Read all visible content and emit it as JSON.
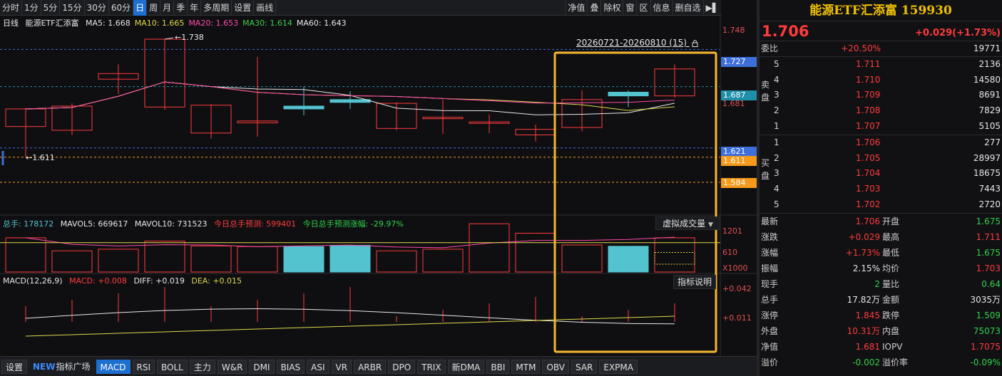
{
  "toolbar": {
    "periods": [
      "分时",
      "1分",
      "5分",
      "15分",
      "30分",
      "60分",
      "日",
      "周",
      "月",
      "季",
      "年",
      "多周期",
      "设置",
      "画线"
    ],
    "active_period": "日",
    "right_items": [
      "净值",
      "叠",
      "除权",
      "窗",
      "区",
      "信息",
      "删自选",
      "▶▌"
    ]
  },
  "chart": {
    "period_label": "日线",
    "name": "能源ETF汇添富",
    "ma_labels": [
      {
        "text": "MA5: 1.668",
        "color": "#e8e8e8"
      },
      {
        "text": "MA10: 1.665",
        "color": "#e0d84a"
      },
      {
        "text": "MA20: 1.653",
        "color": "#ff4aa8"
      },
      {
        "text": "MA30: 1.614",
        "color": "#3ecf4a"
      },
      {
        "text": "MA60: 1.643",
        "color": "#e8e8e8"
      }
    ],
    "range_label": "20260721-20260810 (15)",
    "lock_icon": "lock-icon",
    "price_axis": {
      "top": "1.748",
      "line1": "1.727",
      "line2": "1.687",
      "line2_sub": "1.681",
      "line3": "1.621",
      "line3_sub": "1.611",
      "line4": "1.584"
    },
    "high_marker": "1.738",
    "low_marker": "1.611",
    "candles": [
      {
        "o": 1.644,
        "c": 1.663,
        "h": 1.664,
        "l": 1.611
      },
      {
        "o": 1.64,
        "c": 1.666,
        "h": 1.669,
        "l": 1.635
      },
      {
        "o": 1.695,
        "c": 1.701,
        "h": 1.711,
        "l": 1.679
      },
      {
        "o": 1.665,
        "c": 1.738,
        "h": 1.738,
        "l": 1.662
      },
      {
        "o": 1.637,
        "c": 1.667,
        "h": 1.668,
        "l": 1.631
      },
      {
        "o": 1.648,
        "c": 1.65,
        "h": 1.719,
        "l": 1.633
      },
      {
        "o": 1.666,
        "c": 1.663,
        "h": 1.687,
        "l": 1.656
      },
      {
        "o": 1.673,
        "c": 1.67,
        "h": 1.682,
        "l": 1.663
      },
      {
        "o": 1.642,
        "c": 1.669,
        "h": 1.67,
        "l": 1.64
      },
      {
        "o": 1.654,
        "c": 1.654,
        "h": 1.673,
        "l": 1.636
      },
      {
        "o": 1.649,
        "c": 1.649,
        "h": 1.657,
        "l": 1.637
      },
      {
        "o": 1.635,
        "c": 1.641,
        "h": 1.646,
        "l": 1.628
      },
      {
        "o": 1.643,
        "c": 1.673,
        "h": 1.683,
        "l": 1.639
      },
      {
        "o": 1.681,
        "c": 1.677,
        "h": 1.683,
        "l": 1.665
      },
      {
        "o": 1.677,
        "c": 1.706,
        "h": 1.711,
        "l": 1.675
      }
    ],
    "volume_line": {
      "label": "总手: 178172",
      "mavol5": "MAVOL5: 669617",
      "mavol10": "MAVOL10: 731523",
      "forecast": "今日总手预测: 599401",
      "forecast_change": "今日总手预测涨幅: -29.97%"
    },
    "volume_axis": {
      "top": "1201",
      "mid": "610",
      "unit": "X1000"
    },
    "volumes": [
      1050,
      650,
      700,
      950,
      800,
      780,
      780,
      820,
      650,
      700,
      1480,
      1190,
      830,
      790,
      1050
    ],
    "virtual_volume_button": "虚拟成交量",
    "macd_line": {
      "title": "MACD(12,26,9)",
      "macd": "MACD: +0.008",
      "diff": "DIFF: +0.019",
      "dea": "DEA: +0.015"
    },
    "macd_axis": {
      "top": "+0.042",
      "mid": "+0.011"
    },
    "explain_button": "指标说明"
  },
  "tabs": {
    "settings": "设置",
    "new_badge": "NEW",
    "items": [
      "指标广场",
      "MACD",
      "RSI",
      "BOLL",
      "主力",
      "W&R",
      "DMI",
      "BIAS",
      "ASI",
      "VR",
      "ARBR",
      "DPO",
      "TRIX",
      "新DMA",
      "BBI",
      "MTM",
      "OBV",
      "SAR",
      "EXPMA"
    ],
    "active": "MACD"
  },
  "quote": {
    "title": "能源ETF汇添富 159930",
    "price": "1.706",
    "change": "+0.029(+1.73%)",
    "weibi_label": "委比",
    "weibi_value": "+20.50%",
    "weibi_diff": "19771",
    "sell_label": "卖盘",
    "buy_label": "买盘",
    "asks": [
      {
        "level": "5",
        "price": "1.711",
        "vol": "2136"
      },
      {
        "level": "4",
        "price": "1.710",
        "vol": "14580"
      },
      {
        "level": "3",
        "price": "1.709",
        "vol": "8691"
      },
      {
        "level": "2",
        "price": "1.708",
        "vol": "7829"
      },
      {
        "level": "1",
        "price": "1.707",
        "vol": "5105"
      }
    ],
    "bids": [
      {
        "level": "1",
        "price": "1.706",
        "vol": "277"
      },
      {
        "level": "2",
        "price": "1.705",
        "vol": "28997"
      },
      {
        "level": "3",
        "price": "1.704",
        "vol": "18675"
      },
      {
        "level": "4",
        "price": "1.703",
        "vol": "7443"
      },
      {
        "level": "5",
        "price": "1.702",
        "vol": "2720"
      }
    ],
    "stats": [
      {
        "l1": "最新",
        "v1": "1.706",
        "c1": "red",
        "l2": "开盘",
        "v2": "1.675",
        "c2": "green"
      },
      {
        "l1": "涨跌",
        "v1": "+0.029",
        "c1": "red",
        "l2": "最高",
        "v2": "1.711",
        "c2": "red"
      },
      {
        "l1": "涨幅",
        "v1": "+1.73%",
        "c1": "red",
        "l2": "最低",
        "v2": "1.675",
        "c2": "green"
      },
      {
        "l1": "振幅",
        "v1": "2.15%",
        "c1": "white",
        "l2": "均价",
        "v2": "1.703",
        "c2": "red"
      },
      {
        "l1": "现手",
        "v1": "2",
        "c1": "green",
        "l2": "量比",
        "v2": "0.64",
        "c2": "green"
      },
      {
        "l1": "总手",
        "v1": "17.82万",
        "c1": "white",
        "l2": "金额",
        "v2": "3035万",
        "c2": "white"
      },
      {
        "l1": "涨停",
        "v1": "1.845",
        "c1": "red",
        "l2": "跌停",
        "v2": "1.509",
        "c2": "green"
      },
      {
        "l1": "外盘",
        "v1": "10.31万",
        "c1": "red",
        "l2": "内盘",
        "v2": "75073",
        "c2": "green"
      },
      {
        "l1": "净值",
        "v1": "1.681",
        "c1": "red",
        "l2": "IOPV",
        "v2": "1.7075",
        "c2": "red"
      },
      {
        "l1": "溢价",
        "v1": "-0.002",
        "c1": "green",
        "l2": "溢价率",
        "v2": "-0.09%",
        "c2": "green"
      }
    ]
  },
  "colors": {
    "up": "#ff3b3b",
    "down": "#52c3cf",
    "active": "#1e6fd0",
    "selection": "#f5b731"
  }
}
